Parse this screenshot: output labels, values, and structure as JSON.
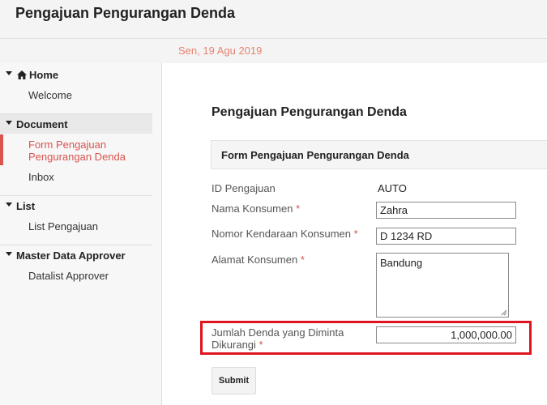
{
  "header": {
    "title": "Pengajuan Pengurangan Denda"
  },
  "datebar": {
    "date": "Sen, 19 Agu 2019"
  },
  "sidebar": {
    "groups": [
      {
        "label": "Home",
        "icon": "home-icon",
        "items": [
          "Welcome"
        ]
      },
      {
        "label": "Document",
        "items": [
          "Form Pengajuan Pengurangan Denda",
          "Inbox"
        ],
        "active_item": "Form Pengajuan Pengurangan Denda"
      },
      {
        "label": "List",
        "items": [
          "List Pengajuan"
        ]
      },
      {
        "label": "Master Data Approver",
        "items": [
          "Datalist Approver"
        ]
      }
    ],
    "active_color": "#d9534f"
  },
  "main": {
    "page_title": "Pengajuan Pengurangan Denda",
    "panel_title": "Form Pengajuan Pengurangan Denda",
    "fields": {
      "id": {
        "label": "ID Pengajuan",
        "value": "AUTO"
      },
      "nama": {
        "label": "Nama Konsumen",
        "required": "*",
        "value": "Zahra"
      },
      "nomor": {
        "label": "Nomor Kendaraan Konsumen",
        "required": "*",
        "value": "D 1234 RD"
      },
      "alamat": {
        "label": "Alamat Konsumen",
        "required": "*",
        "value": "Bandung"
      },
      "jumlah": {
        "label_line1": "Jumlah Denda yang Diminta",
        "label_line2": "Dikurangi",
        "required": "*",
        "value": "1,000,000.00"
      }
    },
    "submit_label": "Submit",
    "highlight_color": "#e0141e"
  }
}
